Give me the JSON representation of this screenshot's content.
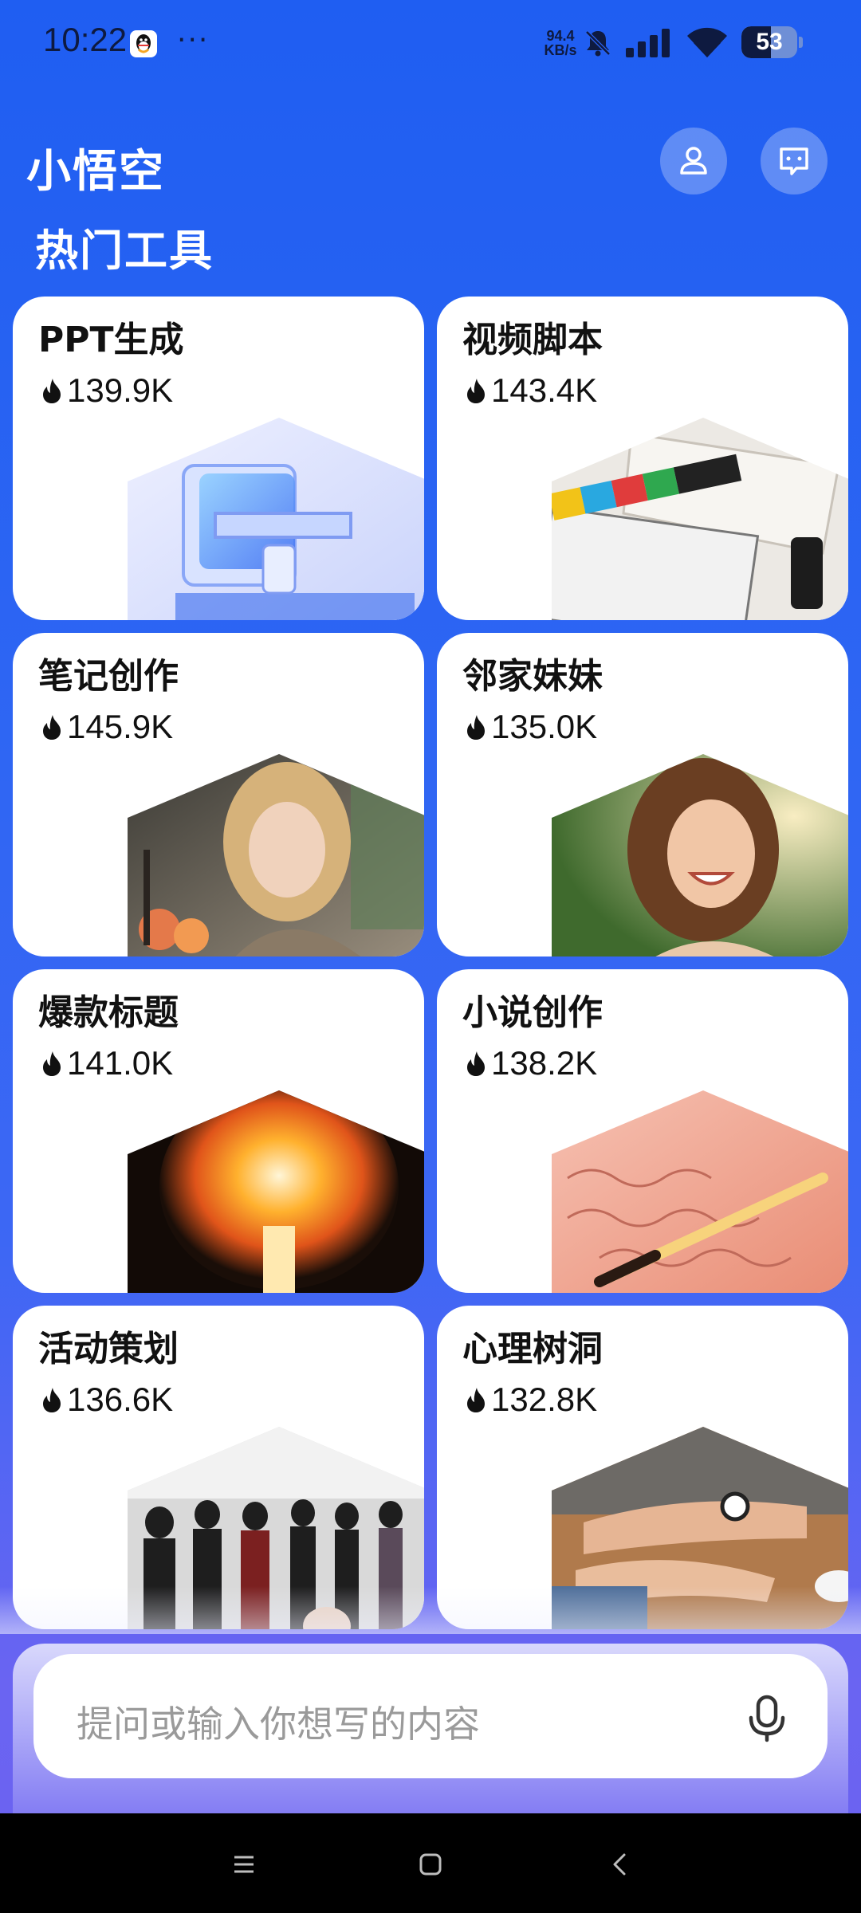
{
  "status_bar": {
    "time": "10:22",
    "dots": "···",
    "net_speed_value": "94.4",
    "net_speed_unit": "KB/s",
    "battery": "53",
    "battery_level": 0.53,
    "icons": [
      "qq-icon",
      "bell-muted-icon",
      "signal-icon",
      "wifi-icon",
      "battery-icon"
    ]
  },
  "header": {
    "app_title": "小悟空",
    "profile_icon": "person-icon",
    "messages_icon": "chat-message-icon"
  },
  "section": {
    "title": "热门工具"
  },
  "tools": [
    {
      "name": "PPT生成",
      "count": "139.9K",
      "image": "glass-presentation-stand"
    },
    {
      "name": "视频脚本",
      "count": "143.4K",
      "image": "film-clapperboard-script"
    },
    {
      "name": "笔记创作",
      "count": "145.9K",
      "image": "woman-portrait-cafe"
    },
    {
      "name": "邻家妹妹",
      "count": "135.0K",
      "image": "laughing-girl-sunlight"
    },
    {
      "name": "爆款标题",
      "count": "141.0K",
      "image": "fiery-explosion"
    },
    {
      "name": "小说创作",
      "count": "138.2K",
      "image": "fountain-pen-handwriting"
    },
    {
      "name": "活动策划",
      "count": "136.6K",
      "image": "event-crowd-party"
    },
    {
      "name": "心理树洞",
      "count": "132.8K",
      "image": "holding-hands-comfort"
    }
  ],
  "input": {
    "placeholder": "提问或输入你想写的内容",
    "mic_icon": "microphone-icon"
  },
  "nav": {
    "icons": [
      "menu-icon",
      "home-icon",
      "back-icon"
    ]
  },
  "colors": {
    "background_top": "#1f5ef2",
    "background_bottom": "#6c62f0",
    "card": "#ffffff",
    "text": "#111111"
  }
}
